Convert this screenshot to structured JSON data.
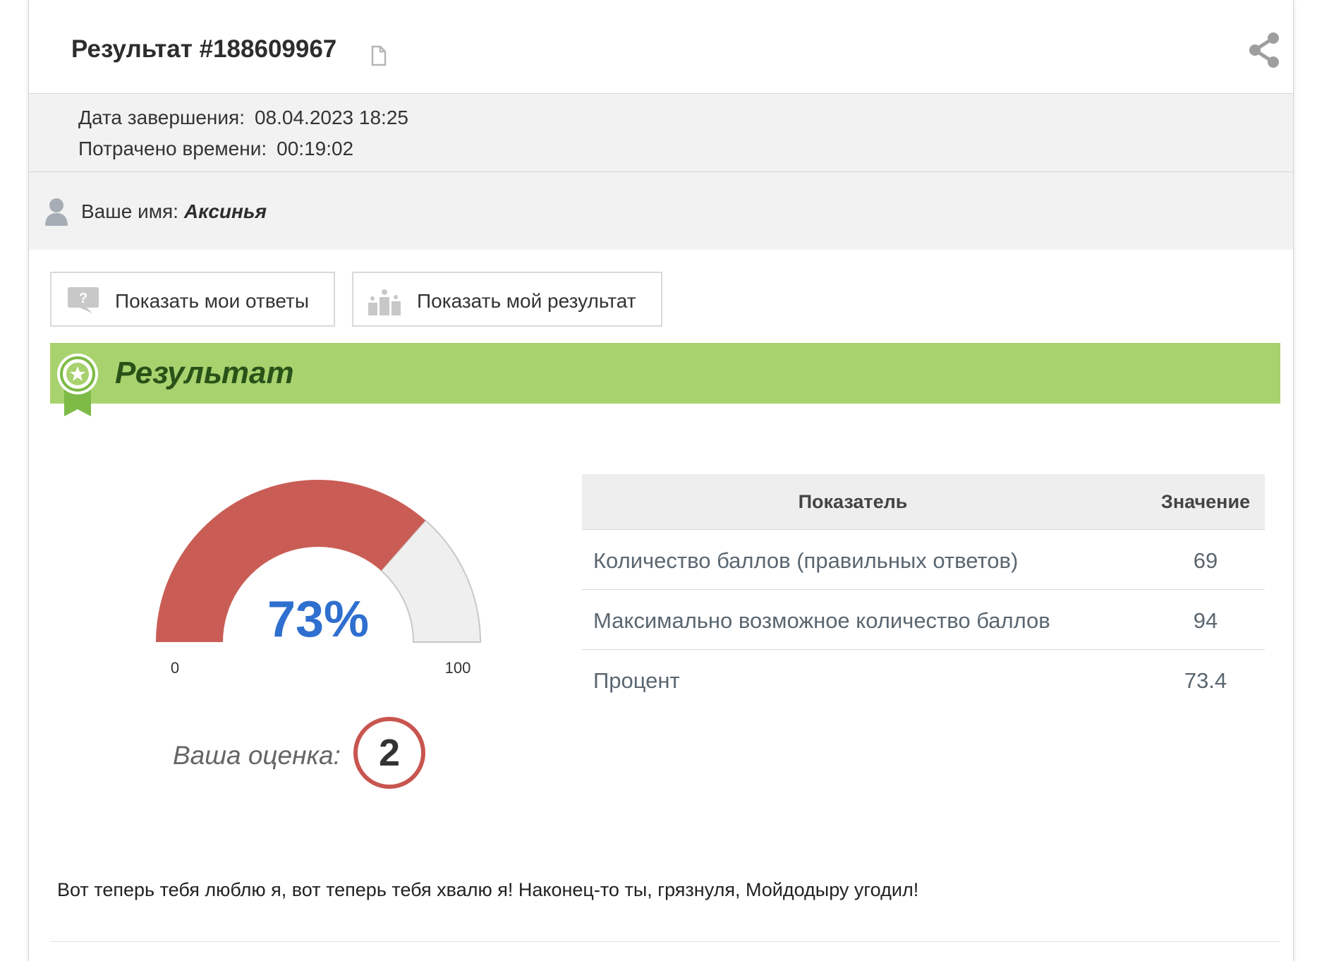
{
  "header": {
    "title": "Результат #188609967"
  },
  "meta": {
    "completed_label": "Дата завершения:",
    "completed_value": "08.04.2023 18:25",
    "time_label": "Потрачено времени:",
    "time_value": "00:19:02"
  },
  "user": {
    "label": "Ваше имя:",
    "name": "Аксинья"
  },
  "buttons": {
    "answers": "Показать мои ответы",
    "result": "Показать мой результат"
  },
  "result_section": {
    "title": "Результат"
  },
  "gauge": {
    "value_text": "73%",
    "value": 73,
    "min": 0,
    "max": 100,
    "min_label": "0",
    "max_label": "100",
    "fill_color": "#c95d55",
    "track_color": "#efefef",
    "text_color": "#2f6fcf"
  },
  "grade": {
    "label": "Ваша оценка:",
    "value": "2",
    "color": "#c8554f"
  },
  "table": {
    "headers": [
      "Показатель",
      "Значение"
    ],
    "rows": [
      {
        "label": "Количество баллов (правильных ответов)",
        "value": "69"
      },
      {
        "label": "Максимально возможное количество баллов",
        "value": "94"
      },
      {
        "label": "Процент",
        "value": "73.4"
      }
    ]
  },
  "message": "Вот теперь тебя люблю я, вот теперь тебя хвалю я! Наконец-то ты, грязнуля, Мойдодыру угодил!",
  "colors": {
    "banner": "#a8d26e",
    "banner_text": "#295218"
  }
}
